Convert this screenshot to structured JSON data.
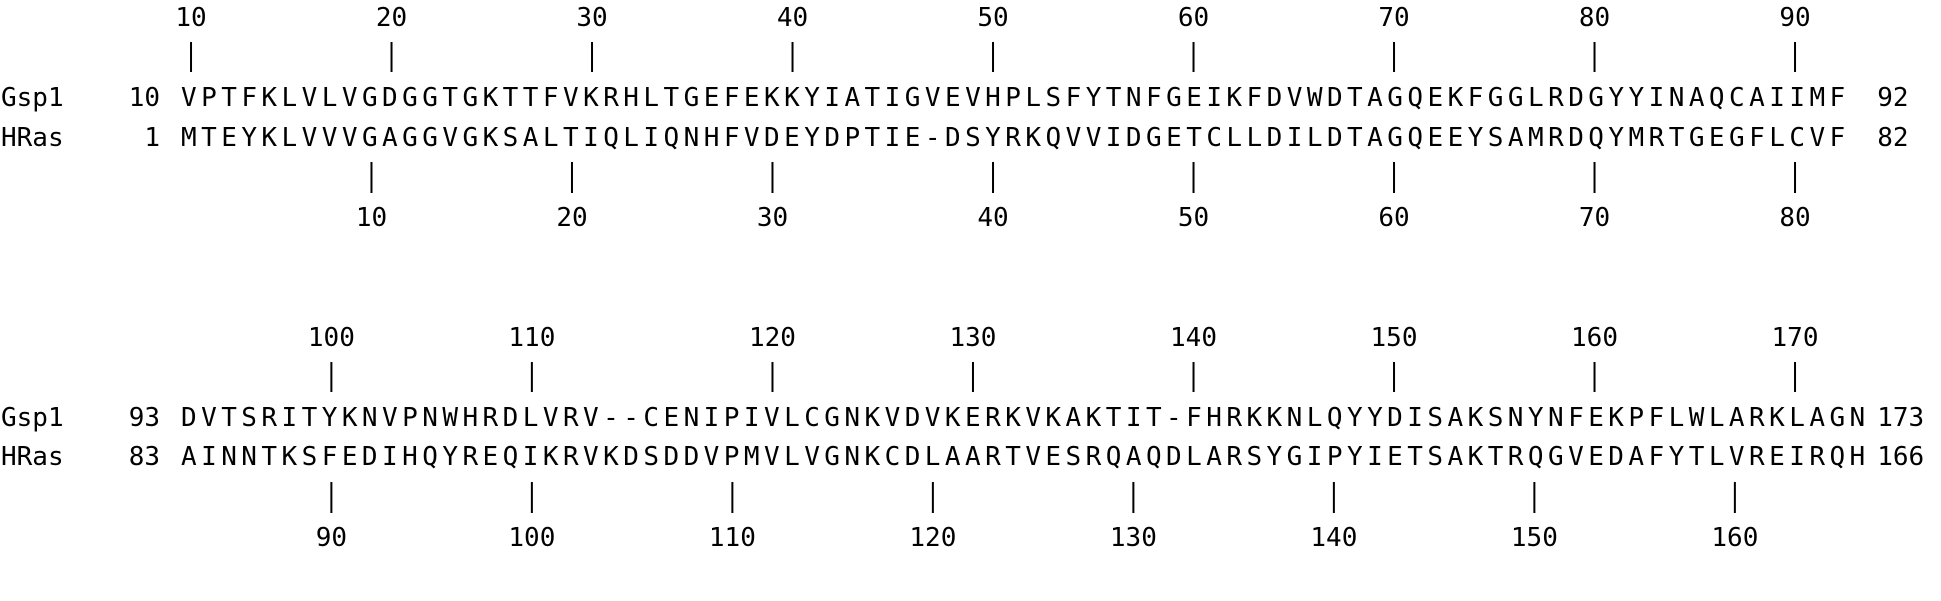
{
  "blocks": [
    {
      "top_positions": [
        "10",
        "20",
        "30",
        "40",
        "50",
        "60",
        "70",
        "80",
        "90"
      ],
      "top_marks": [
        0,
        10,
        20,
        30,
        40,
        50,
        60,
        70,
        80
      ],
      "rows": [
        {
          "name": "Gsp1",
          "start": "10",
          "sequence": "VPTFKLVLVGDGGTGKTTFVKRHLTGEFEKKYIATIGVEVHPLSFYTNFGEIKFDVWDTAGQEKFGGLRDGYYINAQCAIIMF",
          "end": "92"
        },
        {
          "name": "HRas",
          "start": "1",
          "sequence": "MTEYKLVVVGAGGVGKSALTIQLIQNHFVDEYDPTIE-DSYRKQVVIDGETCLLDILDTAGQEEYSAMRDQYMRTGEGFLCVF",
          "end": "82"
        }
      ],
      "bottom_positions": [
        "10",
        "20",
        "30",
        "40",
        "50",
        "60",
        "70",
        "80"
      ],
      "bottom_marks": [
        9,
        19,
        29,
        40,
        50,
        60,
        70,
        80
      ]
    },
    {
      "top_positions": [
        "100",
        "110",
        "120",
        "130",
        "140",
        "150",
        "160",
        "170"
      ],
      "top_marks": [
        7,
        17,
        29,
        39,
        50,
        60,
        70,
        80
      ],
      "rows": [
        {
          "name": "Gsp1",
          "start": "93",
          "sequence": "DVTSRITYKNVPNWHRDLVRV--CENIPIVLCGNKVDVKERKVKAKTIT-FHRKKNLQYYDISAKSNYNFEKPFLWLARKLAGN",
          "end": "173"
        },
        {
          "name": "HRas",
          "start": "83",
          "sequence": "AINNTKSFEDIHQYREQIKRVKDSDDVPMVLVGNKCDLAARTVESRQAQDLARSYGIPYIETSAKTRQGVEDAFYTLVREIRQH",
          "end": "166"
        }
      ],
      "bottom_positions": [
        "90",
        "100",
        "110",
        "120",
        "130",
        "140",
        "150",
        "160"
      ],
      "bottom_marks": [
        7,
        17,
        27,
        37,
        47,
        57,
        67,
        77
      ]
    }
  ]
}
